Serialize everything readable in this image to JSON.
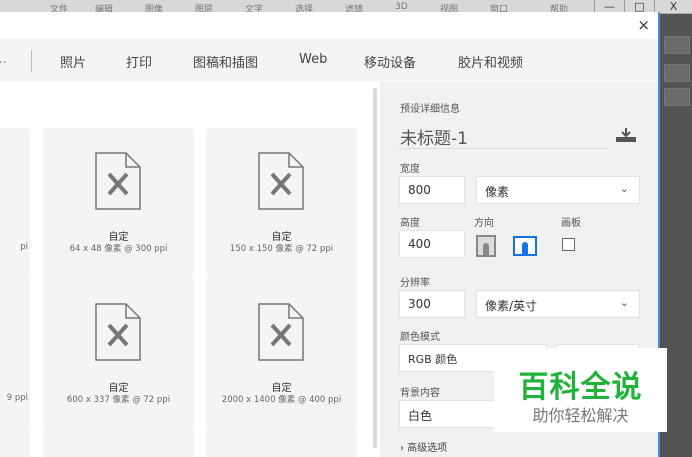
{
  "app_menu": [
    "文件",
    "编辑",
    "图像",
    "图层",
    "文字",
    "选择",
    "滤镜",
    "3D",
    "视图",
    "窗口",
    "帮助"
  ],
  "window_controls": {
    "minimize": "—",
    "maximize": "□",
    "close": "X"
  },
  "dialog": {
    "close": "×",
    "tabs": [
      "照片",
      "打印",
      "图稿和插图",
      "Web",
      "移动设备",
      "胶片和视频"
    ],
    "cards": [
      {
        "title": "",
        "size": "pi"
      },
      {
        "title": "自定",
        "size": "64 x 48 像素 @ 300 ppi"
      },
      {
        "title": "自定",
        "size": "150 x 150 像素 @ 72 ppi"
      },
      {
        "title": "",
        "size": "9 ppi"
      },
      {
        "title": "自定",
        "size": "600 x 337 像素 @ 72 ppi"
      },
      {
        "title": "自定",
        "size": "2000 x 1400 像素 @ 400 ppi"
      }
    ],
    "details": {
      "heading": "预设详细信息",
      "name": "未标题-1",
      "width_label": "宽度",
      "width": "800",
      "width_unit": "像素",
      "height_label": "高度",
      "height": "400",
      "orientation_label": "方向",
      "artboard_label": "画板",
      "resolution_label": "分辨率",
      "resolution": "300",
      "resolution_unit": "像素/英寸",
      "color_mode_label": "颜色模式",
      "color_mode": "RGB 颜色",
      "background_label": "背景内容",
      "background": "白色",
      "advanced": "› 高级选项"
    }
  },
  "watermark": {
    "title": "百科全说",
    "subtitle": "助你轻松解决"
  }
}
